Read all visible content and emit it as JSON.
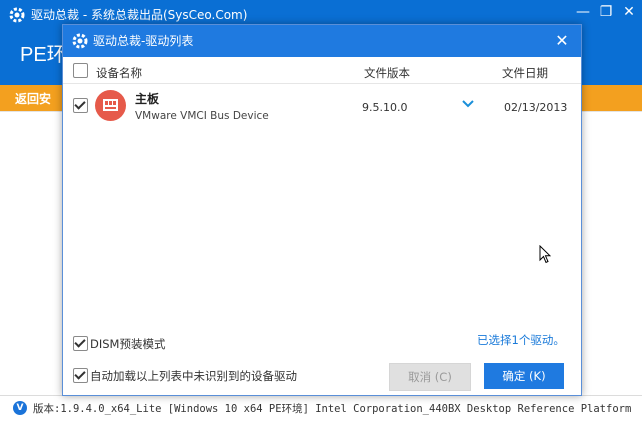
{
  "main_window": {
    "title": "驱动总裁 - 系统总裁出品(SysCeo.Com)",
    "header_title": "PE环",
    "back_button": "返回安",
    "controls": {
      "minimize": "—",
      "restore": "❐",
      "close": "✕"
    }
  },
  "status_bar": {
    "icon_label": "V",
    "text": "版本:1.9.4.0_x64_Lite [Windows 10 x64 PE环境] Intel Corporation_440BX Desktop Reference Platform"
  },
  "dialog": {
    "title": "驱动总裁-驱动列表",
    "close": "✕",
    "columns": {
      "name": "设备名称",
      "version": "文件版本",
      "date": "文件日期"
    },
    "rows": [
      {
        "name": "主板",
        "description": "VMware VMCI Bus Device",
        "version": "9.5.10.0",
        "date": "02/13/2013",
        "checked": true,
        "icon": "motherboard-icon"
      }
    ],
    "options": {
      "dism_label": "DISM预装模式",
      "dism_checked": true,
      "autoload_label": "自动加载以上列表中未识别到的设备驱动",
      "autoload_checked": true
    },
    "selected_summary": "已选择1个驱动。",
    "buttons": {
      "cancel": "取消 (C)",
      "ok": "确定 (K)"
    }
  },
  "colors": {
    "title_blue": "#0a6fd4",
    "dialog_blue": "#1f7ae0",
    "back_orange": "#f3a01f",
    "icon_red": "#e65a4a",
    "link_blue": "#1a7ad9"
  }
}
